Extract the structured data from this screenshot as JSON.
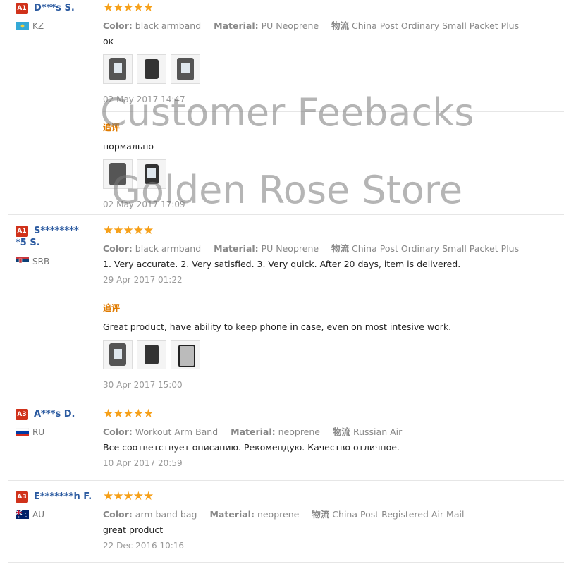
{
  "colors": {
    "accent": "#2b5aa0",
    "badge": "#d0321b",
    "star": "#f6a019",
    "additional": "#e07b00"
  },
  "watermark": {
    "line1": "Customer Feebacks",
    "line2": "Golden Rose Store"
  },
  "labels": {
    "color": "Color:",
    "material": "Material:",
    "shipping": "物流",
    "additional": "追评"
  },
  "reviews": [
    {
      "badge": "A1",
      "name": "D***s S.",
      "country": "KZ",
      "flag": "kz-flag-icon",
      "stars": "★★★★★",
      "color": "black armband",
      "material": "PU Neoprene",
      "shipping": "China Post Ordinary Small Packet Plus",
      "text": "ок",
      "date": "02 May 2017 14:47",
      "followup": {
        "text": "нормально",
        "date": "02 May 2017 17:09"
      }
    },
    {
      "badge": "A1",
      "name": "S*********5 S.",
      "country": "SRB",
      "flag": "rs-flag-icon",
      "stars": "★★★★★",
      "color": "black armband",
      "material": "PU Neoprene",
      "shipping": "China Post Ordinary Small Packet Plus",
      "text": "1. Very accurate. 2. Very satisfied. 3. Very quick. After 20 days, item is delivered.",
      "date": "29 Apr 2017 01:22",
      "followup": {
        "text": "Great product, have ability to keep phone in case, even on most intesive work.",
        "date": "30 Apr 2017 15:00"
      }
    },
    {
      "badge": "A3",
      "name": "A***s D.",
      "country": "RU",
      "flag": "ru-flag-icon",
      "stars": "★★★★★",
      "color": "Workout Arm Band",
      "material": "neoprene",
      "shipping": "Russian Air",
      "text": "Все соответствует описанию. Рекомендую. Качество отличное.",
      "date": "10 Apr 2017 20:59"
    },
    {
      "badge": "A3",
      "name": "E*******h F.",
      "country": "AU",
      "flag": "au-flag-icon",
      "stars": "★★★★★",
      "color": "arm band bag",
      "material": "neoprene",
      "shipping": "China Post Registered Air Mail",
      "text": "great product",
      "date": "22 Dec 2016 10:16"
    }
  ]
}
